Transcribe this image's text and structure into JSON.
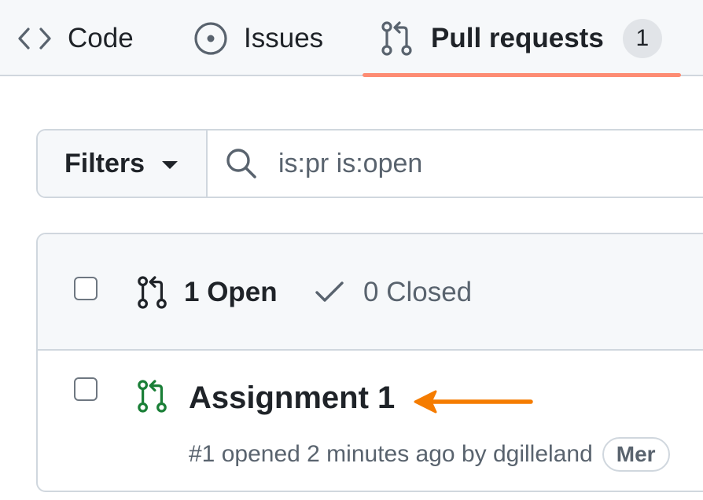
{
  "nav": {
    "tabs": [
      {
        "label": "Code",
        "icon": "code-icon"
      },
      {
        "label": "Issues",
        "icon": "issue-opened-icon"
      },
      {
        "label": "Pull requests",
        "icon": "git-pull-request-icon",
        "counter": "1",
        "selected": true
      }
    ]
  },
  "filterbar": {
    "filters_label": "Filters",
    "search_value": "is:pr is:open"
  },
  "list": {
    "open_label": "1 Open",
    "closed_label": "0 Closed",
    "items": [
      {
        "title": "Assignment 1",
        "number": "#1",
        "opened_text": "opened 2 minutes ago by",
        "author": "dgilleland",
        "badge": "Mer"
      }
    ]
  },
  "colors": {
    "accent_underline": "#fd8c73",
    "open_green": "#1a7f37",
    "arrow_orange": "#f57c00"
  }
}
